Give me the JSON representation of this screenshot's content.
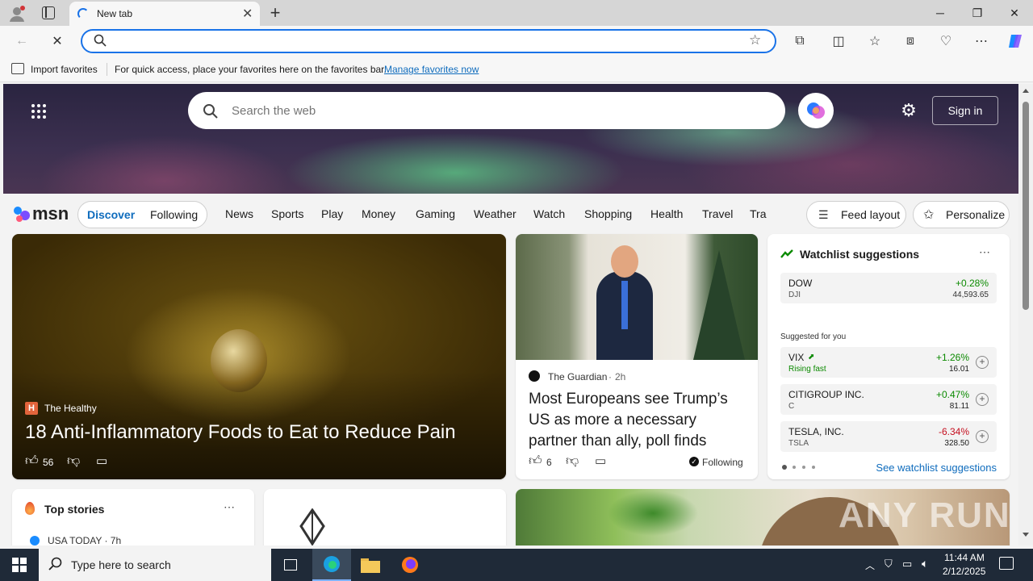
{
  "browser": {
    "tab_title": "New tab",
    "address_value": "",
    "favorites_bar": {
      "import_label": "Import favorites",
      "hint": "For quick access, place your favorites here on the favorites bar.",
      "manage_link": "Manage favorites now"
    }
  },
  "msn": {
    "logo_text": "msn",
    "search_placeholder": "Search the web",
    "sign_in": "Sign in",
    "tabs": [
      {
        "label": "Discover",
        "active": true
      },
      {
        "label": "Following",
        "active": false
      }
    ],
    "nav_items": [
      "News",
      "Sports",
      "Play",
      "Money",
      "Gaming",
      "Weather",
      "Watch",
      "Shopping",
      "Health",
      "Travel",
      "Tra"
    ],
    "feed_layout": "Feed layout",
    "personalize": "Personalize"
  },
  "hero": {
    "source": "The Healthy",
    "source_icon_letter": "H",
    "title": "18 Anti-Inflammatory Foods to Eat to Reduce Pain",
    "likes": "56"
  },
  "news_card": {
    "source": "The Guardian",
    "time": "2h",
    "title": "Most Europeans see Trump’s US as more a necessary partner than ally, poll finds",
    "likes": "6",
    "following": "Following"
  },
  "watchlist": {
    "title": "Watchlist suggestions",
    "main": {
      "name": "DOW",
      "ticker": "DJI",
      "change": "+0.28%",
      "price": "44,593.65"
    },
    "suggested_label": "Suggested for you",
    "suggested": [
      {
        "name": "VIX",
        "sub": "Rising fast",
        "change": "+1.26%",
        "price": "16.01",
        "positive": true
      },
      {
        "name": "CITIGROUP INC.",
        "sub": "C",
        "change": "+0.47%",
        "price": "81.11",
        "positive": true
      },
      {
        "name": "TESLA, INC.",
        "sub": "TSLA",
        "change": "-6.34%",
        "price": "328.50",
        "positive": false
      }
    ],
    "see_link": "See watchlist suggestions"
  },
  "top_stories": {
    "title": "Top stories",
    "first_source": "USA TODAY · 7h"
  },
  "watermark": "ANY RUN",
  "taskbar": {
    "search_placeholder": "Type here to search",
    "time": "11:44 AM",
    "date": "2/12/2025"
  },
  "colors": {
    "accent": "#1a73e8",
    "msn_blue": "#0f6cbd",
    "positive": "#0b8a00",
    "negative": "#c50f1f",
    "taskbar": "#1f2a38"
  }
}
